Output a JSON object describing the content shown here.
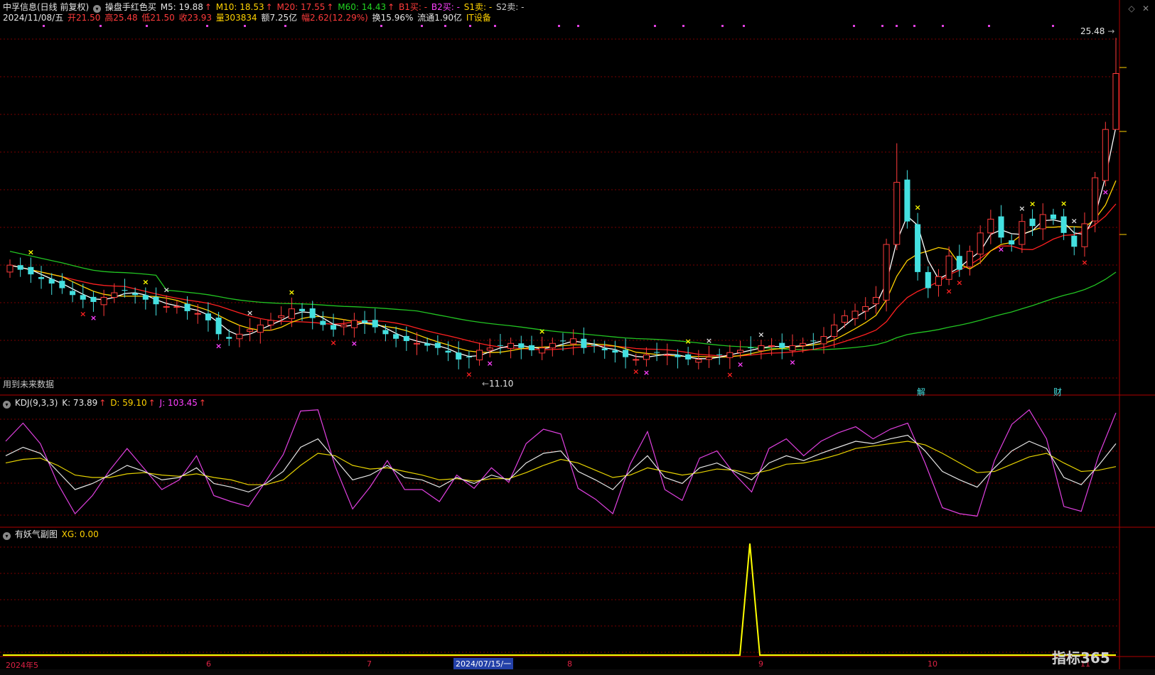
{
  "header": {
    "stock_title": "中孚信息(日线 前复权)",
    "formula_name": "操盘手红色买",
    "ma5": "M5: 19.88",
    "ma10": "M10: 18.53",
    "ma20": "M20: 17.55",
    "ma60": "M60: 14.43",
    "b1": "B1买: -",
    "b2": "B2买: -",
    "s1": "S1卖: -",
    "s2": "S2卖: -",
    "date": "2024/11/08/五",
    "open": "开21.50",
    "high": "高25.48",
    "low": "低21.50",
    "close": "收23.93",
    "volume": "量303834",
    "amount": "额7.25亿",
    "change": "幅2.62(12.29%)",
    "turnover": "换15.96%",
    "float": "流通1.90亿",
    "sector": "IT设备"
  },
  "main_pane": {
    "high_label": "25.48",
    "low_label": "11.10",
    "future_data_note": "用到未来数据",
    "marker_jie": "解",
    "marker_cai": "财"
  },
  "kdj_pane": {
    "title": "KDJ(9,3,3)",
    "k": "K: 73.89",
    "d": "D: 59.10",
    "j": "J: 103.45"
  },
  "yaoqi_pane": {
    "title": "有妖气副图",
    "xg": "XG: 0.00"
  },
  "x_axis": {
    "labels": [
      "2024年5",
      "6",
      "7",
      "8",
      "9",
      "10",
      "11"
    ],
    "selected": "2024/07/15/一"
  },
  "logo": "指标365",
  "colors": {
    "up": "#ff3b3b",
    "down": "#44e0e0",
    "ma5": "#ffffff",
    "ma10": "#ffd200",
    "ma20": "#ff2020",
    "ma60": "#22c422",
    "k": "#e6e6e6",
    "d": "#e6d200",
    "j": "#e040e0",
    "xg": "#ffff00",
    "grid": "#7a0000"
  },
  "chart_data": {
    "type": "candlestick",
    "dates": [
      "2024-05",
      "2024-06",
      "2024-07",
      "2024-08",
      "2024-09",
      "2024-10",
      "2024-11"
    ],
    "latest": {
      "open": 21.5,
      "high": 25.48,
      "low": 21.5,
      "close": 23.93
    },
    "annotations": {
      "high": 25.48,
      "low": 11.1
    },
    "closes": [
      15.6,
      15.4,
      15.2,
      15.0,
      14.8,
      14.6,
      14.3,
      14.1,
      14.0,
      14.2,
      14.4,
      14.5,
      14.3,
      14.1,
      13.9,
      13.8,
      13.8,
      13.6,
      13.5,
      13.2,
      12.6,
      12.4,
      12.6,
      12.8,
      13.0,
      13.2,
      13.4,
      13.7,
      13.6,
      13.3,
      13.0,
      12.8,
      13.0,
      13.2,
      13.1,
      12.9,
      12.6,
      12.4,
      12.3,
      12.2,
      12.1,
      12.0,
      11.8,
      11.5,
      11.6,
      11.9,
      12.0,
      12.1,
      12.2,
      12.0,
      11.9,
      12.0,
      12.2,
      12.3,
      12.4,
      12.0,
      12.1,
      11.9,
      11.8,
      11.6,
      11.5,
      11.7,
      11.8,
      11.7,
      11.6,
      11.5,
      11.5,
      11.6,
      11.7,
      11.8,
      11.9,
      12.0,
      12.1,
      12.1,
      12.0,
      12.1,
      12.2,
      12.3,
      12.5,
      13.0,
      13.4,
      13.6,
      13.8,
      14.2,
      16.5,
      19.2,
      17.5,
      15.3,
      14.6,
      15.1,
      16.0,
      15.4,
      16.2,
      17.0,
      17.6,
      16.8,
      16.5,
      17.5,
      17.3,
      17.8,
      17.6,
      17.0,
      16.4,
      17.4,
      19.4,
      21.5,
      23.93
    ],
    "kdj": {
      "k": [
        68,
        75,
        70,
        55,
        40,
        45,
        52,
        60,
        55,
        48,
        50,
        58,
        45,
        42,
        38,
        45,
        55,
        75,
        82,
        65,
        48,
        52,
        60,
        50,
        48,
        42,
        50,
        45,
        52,
        48,
        62,
        70,
        72,
        55,
        48,
        40,
        55,
        68,
        50,
        45,
        58,
        62,
        55,
        48,
        62,
        68,
        64,
        70,
        75,
        80,
        78,
        82,
        85,
        72,
        55,
        48,
        42,
        58,
        72,
        80,
        74,
        50,
        44,
        60,
        78
      ],
      "d": [
        62,
        65,
        66,
        60,
        52,
        50,
        50,
        53,
        54,
        52,
        51,
        53,
        50,
        48,
        44,
        44,
        48,
        60,
        70,
        68,
        60,
        57,
        58,
        55,
        52,
        48,
        49,
        47,
        49,
        49,
        54,
        60,
        65,
        62,
        56,
        50,
        52,
        58,
        55,
        52,
        54,
        57,
        56,
        53,
        56,
        61,
        62,
        65,
        69,
        74,
        76,
        78,
        80,
        77,
        70,
        62,
        54,
        55,
        61,
        67,
        70,
        62,
        55,
        56,
        59
      ],
      "j": [
        80,
        95,
        78,
        45,
        20,
        35,
        56,
        74,
        57,
        40,
        48,
        68,
        35,
        30,
        26,
        47,
        69,
        105,
        106,
        59,
        24,
        42,
        64,
        40,
        40,
        30,
        52,
        41,
        58,
        46,
        78,
        90,
        86,
        41,
        32,
        20,
        61,
        88,
        40,
        31,
        66,
        72,
        53,
        38,
        74,
        82,
        68,
        80,
        87,
        92,
        82,
        90,
        95,
        62,
        25,
        20,
        18,
        64,
        94,
        106,
        82,
        26,
        22,
        68,
        103.45
      ]
    },
    "xg_spike_month": "2024-09"
  }
}
